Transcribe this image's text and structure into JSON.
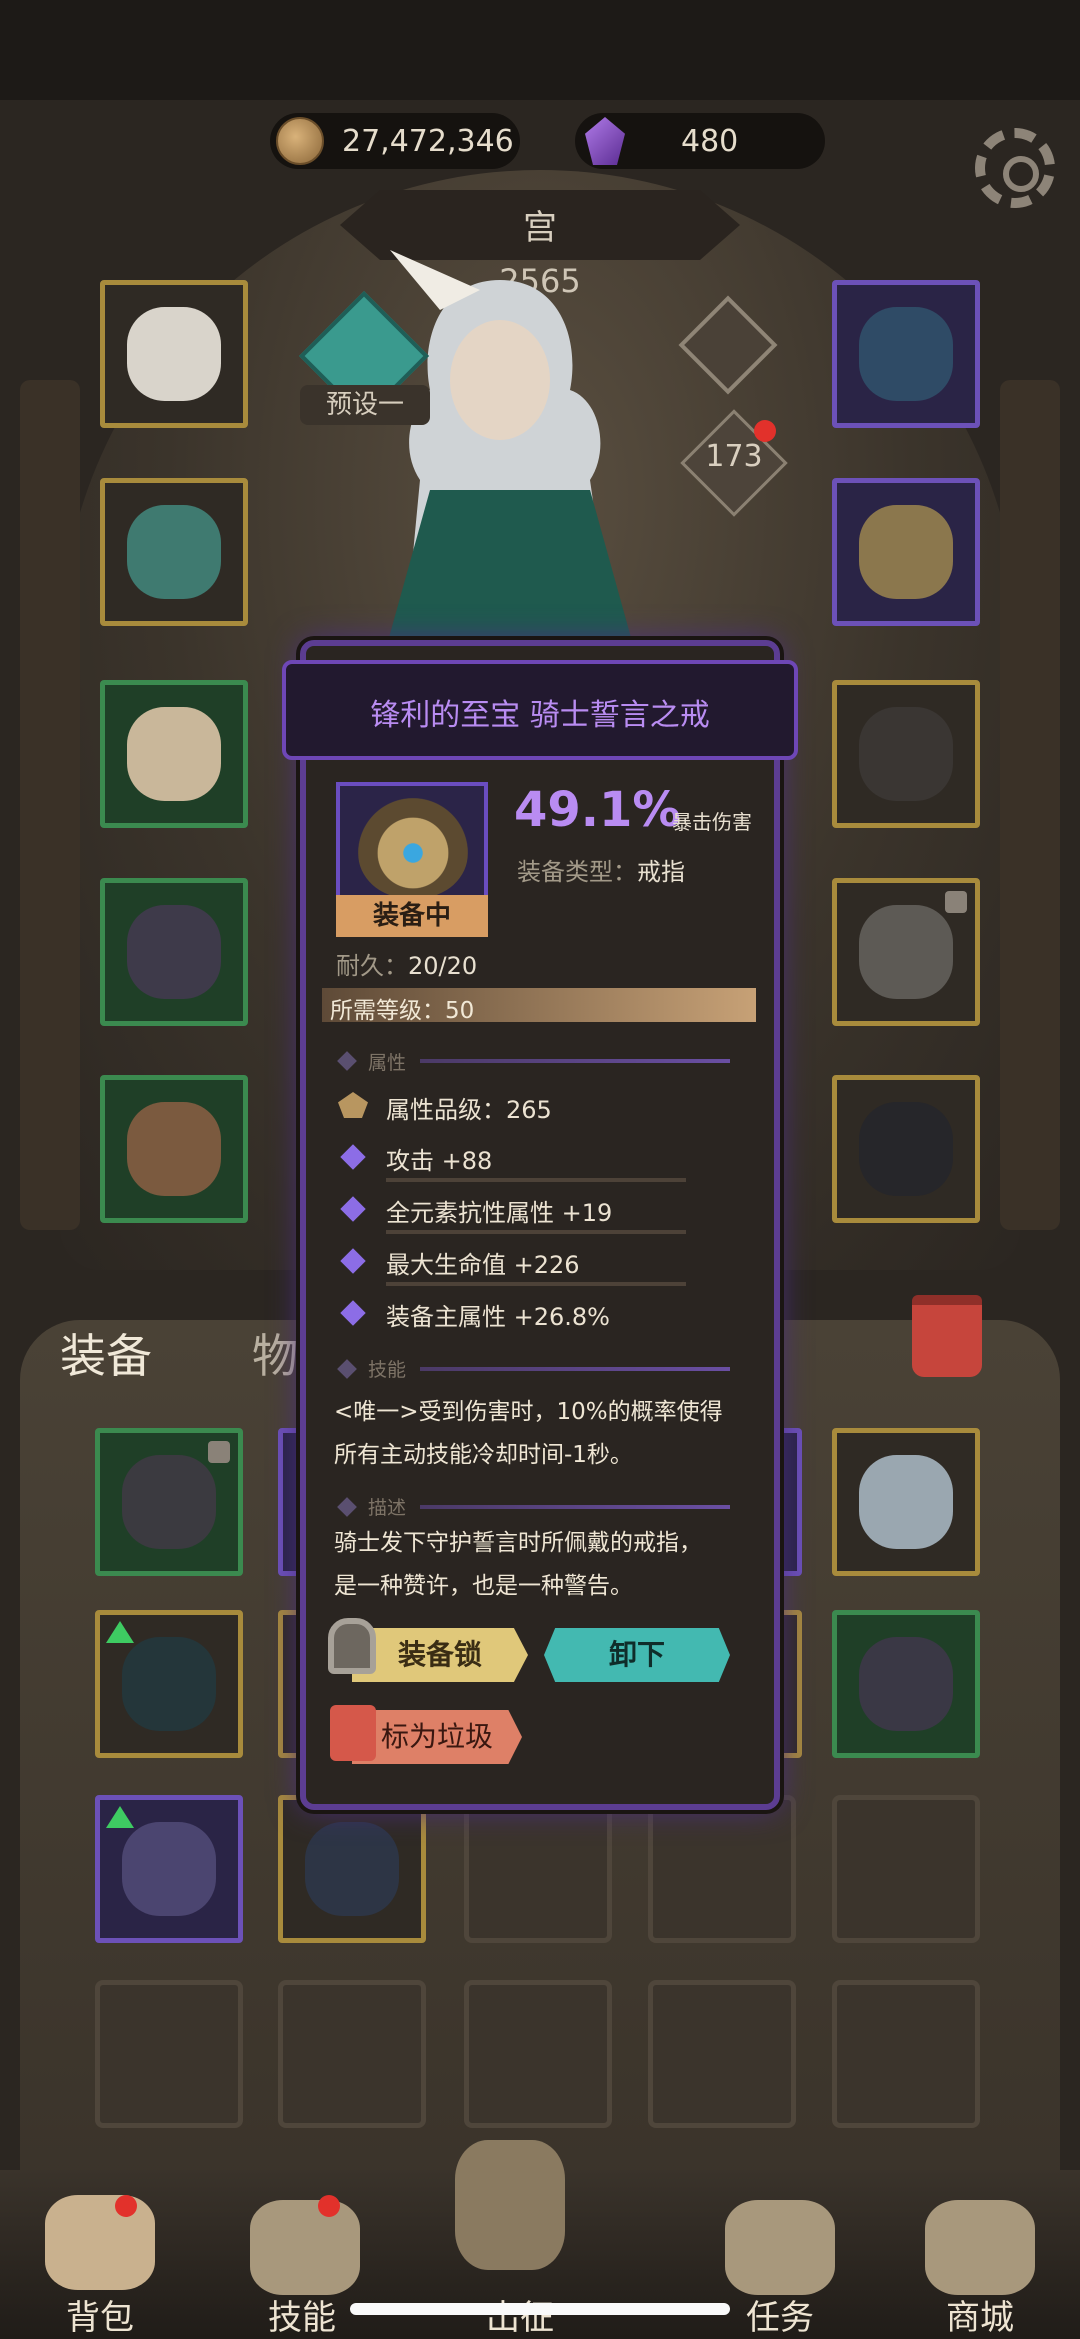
{
  "currency": {
    "gold": "27,472,346",
    "gems": "480"
  },
  "header": {
    "title": "宫",
    "power": "2565",
    "preset_label": "预设一",
    "level_badge": "173"
  },
  "tabs": {
    "equipment": "装备",
    "items": "物"
  },
  "bottom_nav": [
    {
      "label": "背包",
      "icon": "backpack-icon"
    },
    {
      "label": "技能",
      "icon": "skill-book-icon"
    },
    {
      "label": "出征",
      "icon": "sword-icon"
    },
    {
      "label": "任务",
      "icon": "task-scroll-icon"
    },
    {
      "label": "商城",
      "icon": "shop-crown-icon"
    }
  ],
  "item_popup": {
    "title": "锋利的至宝 骑士誓言之戒",
    "equipped_label": "装备中",
    "main_stat_value": "49.1%",
    "main_stat_label": "暴击伤害",
    "type_label": "装备类型：",
    "type_value": "戒指",
    "durability_label": "耐久：",
    "durability_value": "20/20",
    "required_level_label": "所需等级：",
    "required_level_value": "50",
    "section_attributes": "属性",
    "attribute_grade_label": "属性品级：",
    "attribute_grade_value": "265",
    "stats": [
      "攻击 +88",
      "全元素抗性属性 +19",
      "最大生命值 +226",
      "装备主属性 +26.8%"
    ],
    "section_skill": "技能",
    "skill_text_1": "<唯一>受到伤害时，10%的概率使得",
    "skill_text_2": "所有主动技能冷却时间-1秒。",
    "section_description": "描述",
    "description_1": "骑士发下守护誓言时所佩戴的戒指，",
    "description_2": "是一种赞许，也是一种警告。",
    "btn_lock": "装备锁",
    "btn_unequip": "卸下",
    "btn_junk": "标为垃圾"
  },
  "colors": {
    "accent_purple": "#b98cf2",
    "unequip_teal": "#43b9b1",
    "lock_gold": "#e0c87a",
    "junk_red": "#de8067"
  }
}
